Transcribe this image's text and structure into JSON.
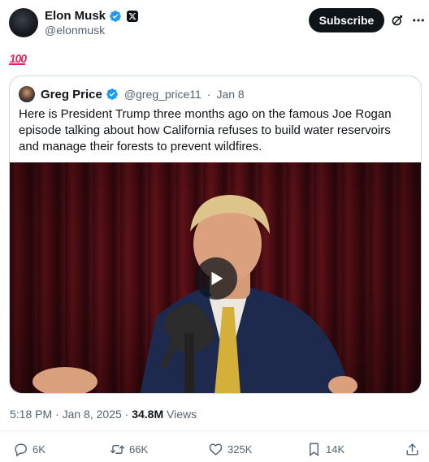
{
  "author": {
    "name": "Elon Musk",
    "handle": "@elonmusk",
    "badge_color": "#1d9bf0"
  },
  "header_actions": {
    "subscribe_label": "Subscribe",
    "grok_icon": "grok-icon",
    "more_icon": "more-icon"
  },
  "post": {
    "emoji": "100",
    "emoji_name": "hundred-points-emoji"
  },
  "quote": {
    "name": "Greg Price",
    "handle": "@greg_price11",
    "separator": "·",
    "date": "Jan 8",
    "text": "Here is President Trump three months ago on the famous Joe Rogan episode talking about how California refuses to build water reservoirs and manage their forests to prevent wildfires.",
    "media_icon": "play-icon"
  },
  "meta": {
    "time": "5:18 PM",
    "sep1": "·",
    "date": "Jan 8, 2025",
    "sep2": "·",
    "views": "34.8M",
    "views_label": "Views"
  },
  "actions": {
    "replies": "6K",
    "reposts": "66K",
    "likes": "325K",
    "bookmarks": "14K"
  },
  "colors": {
    "text": "#0f1419",
    "secondary": "#536471",
    "border": "#cfd9de",
    "verified": "#1d9bf0",
    "button_bg": "#0f1419"
  }
}
